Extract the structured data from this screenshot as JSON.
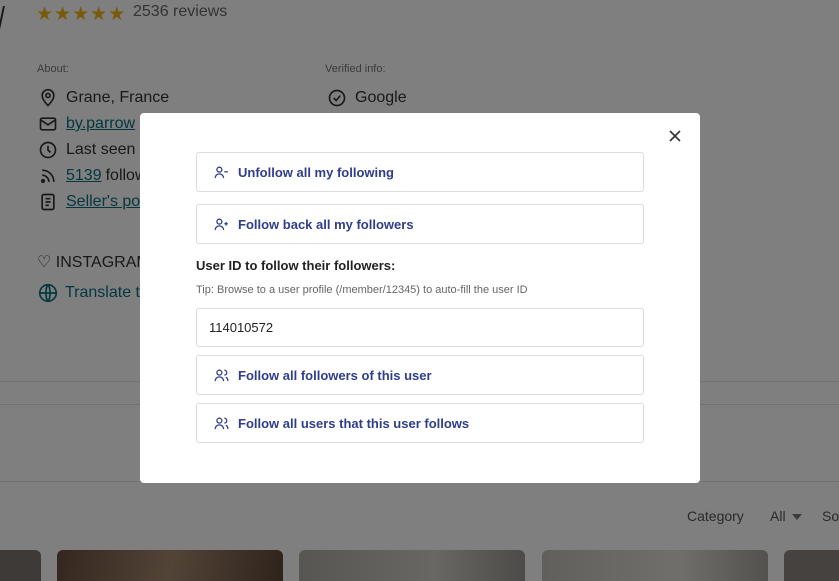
{
  "profile": {
    "rating_stars": 5,
    "reviews_text": "2536 reviews",
    "about_label": "About:",
    "verified_label": "Verified info:",
    "location": "Grane, France",
    "email_partial": "by.parrow",
    "last_seen_partial": "Last seen",
    "followers_count": "5139",
    "followers_partial": "follow",
    "sellers_policy_partial": "Seller's po",
    "verified_google": "Google",
    "instagram_partial": "♡ INSTAGRAM",
    "translate_partial": "Translate t"
  },
  "filters": {
    "category_label": "Category",
    "category_value": "All",
    "sort_partial": "So"
  },
  "modal": {
    "unfollow_all_label": "Unfollow all my following",
    "follow_back_label": "Follow back all my followers",
    "user_id_label": "User ID to follow their followers:",
    "tip_text": "Tip: Browse to a user profile (/member/12345) to auto-fill the user ID",
    "user_id_value": "114010572",
    "follow_followers_label": "Follow all followers of this user",
    "follow_following_label": "Follow all users that this user follows"
  },
  "icons": {
    "close": "close-icon",
    "user_minus": "user-minus-icon",
    "user_plus": "user-plus-icon",
    "users": "users-icon"
  },
  "colors": {
    "accent_blue": "#2f3e8c",
    "link_teal": "#0a6e7e",
    "star": "#f2b417",
    "overlay": "rgba(0,0,0,0.5)"
  }
}
